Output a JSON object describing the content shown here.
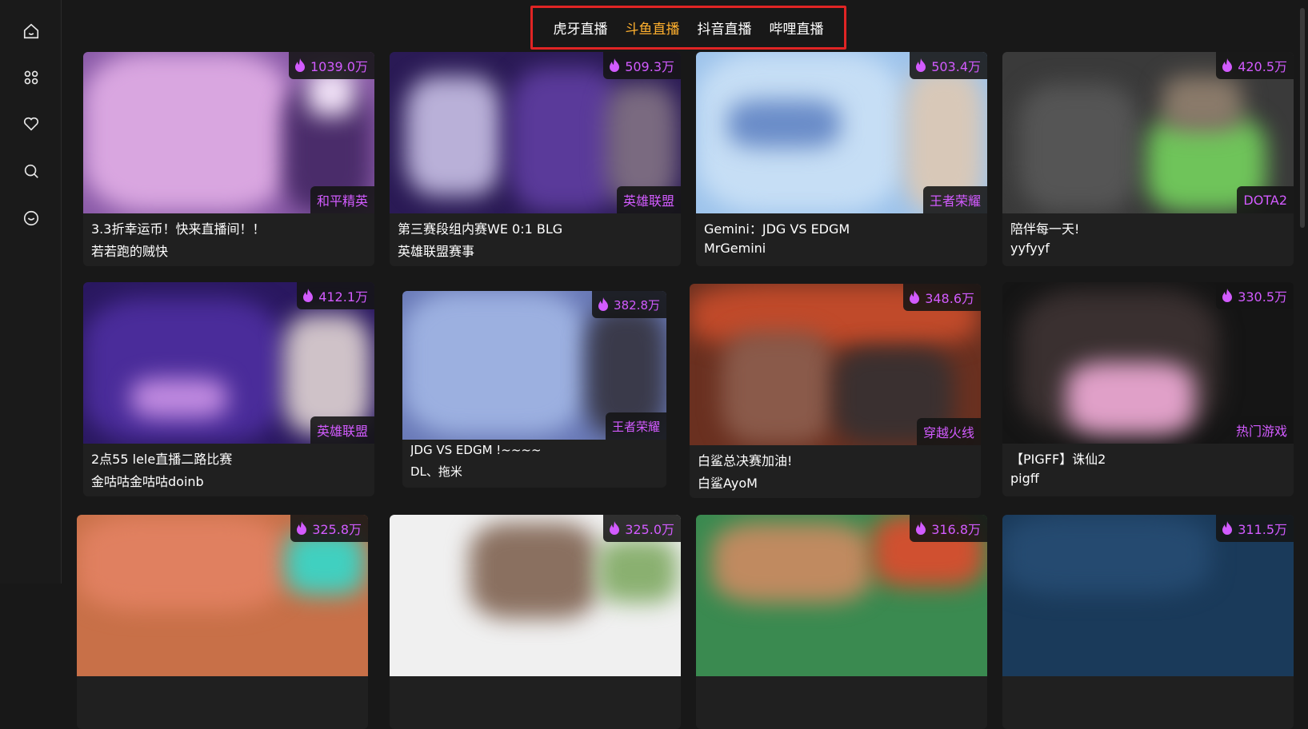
{
  "sidebar": {
    "items": [
      {
        "name": "home-icon"
      },
      {
        "name": "apps-icon"
      },
      {
        "name": "heart-icon"
      },
      {
        "name": "search-icon"
      },
      {
        "name": "profile-icon"
      }
    ]
  },
  "platform_tabs": [
    {
      "label": "虎牙直播",
      "active": false
    },
    {
      "label": "斗鱼直播",
      "active": true
    },
    {
      "label": "抖音直播",
      "active": false
    },
    {
      "label": "哔哩直播",
      "active": false
    }
  ],
  "colors": {
    "accent_active_tab": "#ffb02e",
    "heat_and_category": "#d25bff",
    "highlight_border": "#e02424"
  },
  "cards": [
    {
      "heat": "1039.0万",
      "category": "和平精英",
      "title": "3.3折幸运币！快来直播间！！",
      "anchor": "若若跑的贼快"
    },
    {
      "heat": "509.3万",
      "category": "英雄联盟",
      "title": "第三赛段组内赛WE 0:1 BLG",
      "anchor": "英雄联盟赛事"
    },
    {
      "heat": "503.4万",
      "category": "王者荣耀",
      "title": "Gemini：JDG VS EDGM",
      "anchor": "MrGemini"
    },
    {
      "heat": "420.5万",
      "category": "DOTA2",
      "title": "陪伴每一天!",
      "anchor": "yyfyyf"
    },
    {
      "heat": "412.1万",
      "category": "英雄联盟",
      "title": "2点55 lele直播二路比赛",
      "anchor": "金咕咕金咕咕doinb"
    },
    {
      "heat": "382.8万",
      "category": "王者荣耀",
      "title": "JDG VS EDGM !~~~~",
      "anchor": "DL、拖米"
    },
    {
      "heat": "348.6万",
      "category": "穿越火线",
      "title": "白鲨总决赛加油!",
      "anchor": "白鲨AyoM"
    },
    {
      "heat": "330.5万",
      "category": "热门游戏",
      "title": "【PIGFF】诛仙2",
      "anchor": "pigff"
    },
    {
      "heat": "325.8万",
      "category": "",
      "title": "",
      "anchor": ""
    },
    {
      "heat": "325.0万",
      "category": "",
      "title": "",
      "anchor": ""
    },
    {
      "heat": "316.8万",
      "category": "",
      "title": "",
      "anchor": ""
    },
    {
      "heat": "311.5万",
      "category": "",
      "title": "",
      "anchor": ""
    }
  ]
}
